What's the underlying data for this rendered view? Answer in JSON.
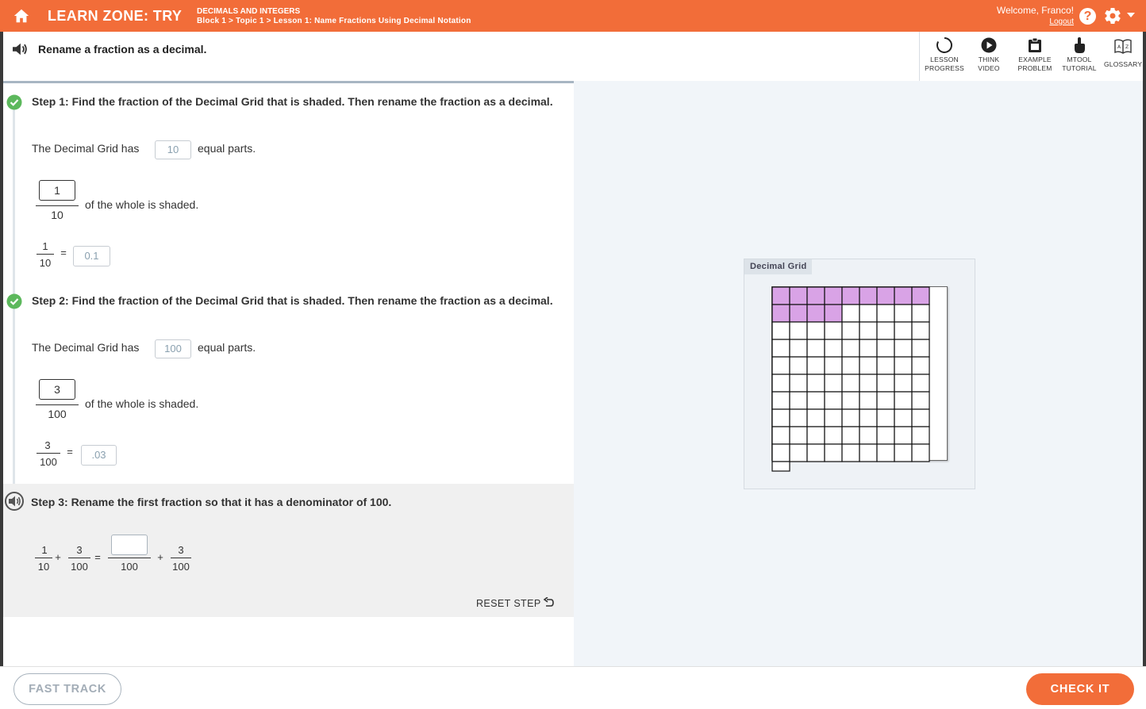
{
  "header": {
    "zone_title": "LEARN ZONE: TRY",
    "course_title": "DECIMALS AND INTEGERS",
    "breadcrumb": "Block 1 > Topic 1 > Lesson 1: Name Fractions Using Decimal Notation",
    "welcome": "Welcome, Franco!",
    "logout": "Logout",
    "help_label": "?"
  },
  "instruction": {
    "text": "Rename a fraction as a decimal."
  },
  "toolbar": {
    "items": [
      {
        "line1": "LESSON",
        "line2": "PROGRESS",
        "icon": "lesson-progress-icon"
      },
      {
        "line1": "THINK",
        "line2": "VIDEO",
        "icon": "play-icon"
      },
      {
        "line1": "EXAMPLE",
        "line2": "PROBLEM",
        "icon": "example-problem-icon"
      },
      {
        "line1": "MTOOL",
        "line2": "TUTORIAL",
        "icon": "hand-pointer-icon"
      },
      {
        "line1": "GLOSSARY",
        "line2": "",
        "icon": "glossary-book-icon"
      }
    ]
  },
  "step1": {
    "title": "Step 1: Find the fraction of the Decimal Grid that is shaded. Then rename the fraction as a decimal.",
    "grid_has_prefix": "The Decimal Grid has",
    "parts_value": "10",
    "grid_has_suffix": "equal parts.",
    "numerator": "1",
    "denominator": "10",
    "shaded_text": "of the whole is shaded.",
    "eq_numerator": "1",
    "eq_denominator": "10",
    "equals": "=",
    "decimal_value": "0.1"
  },
  "step2": {
    "title": "Step 2: Find the fraction of the Decimal Grid that is shaded. Then rename the fraction as a decimal.",
    "grid_has_prefix": "The Decimal Grid has",
    "parts_value": "100",
    "grid_has_suffix": "equal parts.",
    "numerator": "3",
    "denominator": "100",
    "shaded_text": "of the whole is shaded.",
    "eq_numerator": "3",
    "eq_denominator": "100",
    "equals": "=",
    "decimal_value": ".03"
  },
  "step3": {
    "title": "Step 3: Rename the first fraction so that it has a denominator of 100.",
    "frac1_num": "1",
    "frac1_den": "10",
    "plus1": "+",
    "frac2_num": "3",
    "frac2_den": "100",
    "equals": "=",
    "blank_den": "100",
    "plus2": "+",
    "frac4_num": "3",
    "frac4_den": "100",
    "reset_label": "RESET STEP"
  },
  "decimal_grid": {
    "label": "Decimal Grid",
    "rows": 10,
    "cols": 10,
    "shaded_cells": 13,
    "shade_color": "#d9a3e6"
  },
  "footer": {
    "fast_track": "FAST TRACK",
    "check_it": "CHECK IT"
  },
  "colors": {
    "brand_orange": "#f26d39",
    "check_green": "#5cb85c"
  }
}
